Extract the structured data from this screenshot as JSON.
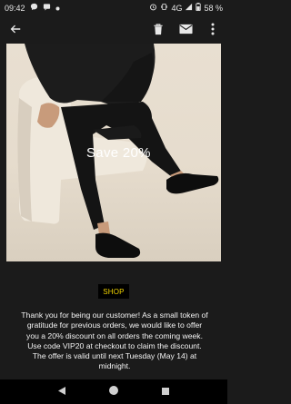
{
  "status": {
    "time": "09:42",
    "network": "4G",
    "battery": "58 %"
  },
  "toolbar": {
    "back": "back",
    "delete": "delete",
    "mark_unread": "mark-unread",
    "more": "more"
  },
  "hero": {
    "overlay_text": "Save 20%"
  },
  "shop_button": "SHOP",
  "message": "Thank you for being our customer! As a small token of gratitude for previous orders, we would like to offer you a 20% discount on all orders the coming week. Use code VIP20 at checkout to claim the discount. The offer is valid until next Tuesday (May 14) at midnight.",
  "colors": {
    "background": "#1b1b1b",
    "shop_text": "#f2d400"
  }
}
